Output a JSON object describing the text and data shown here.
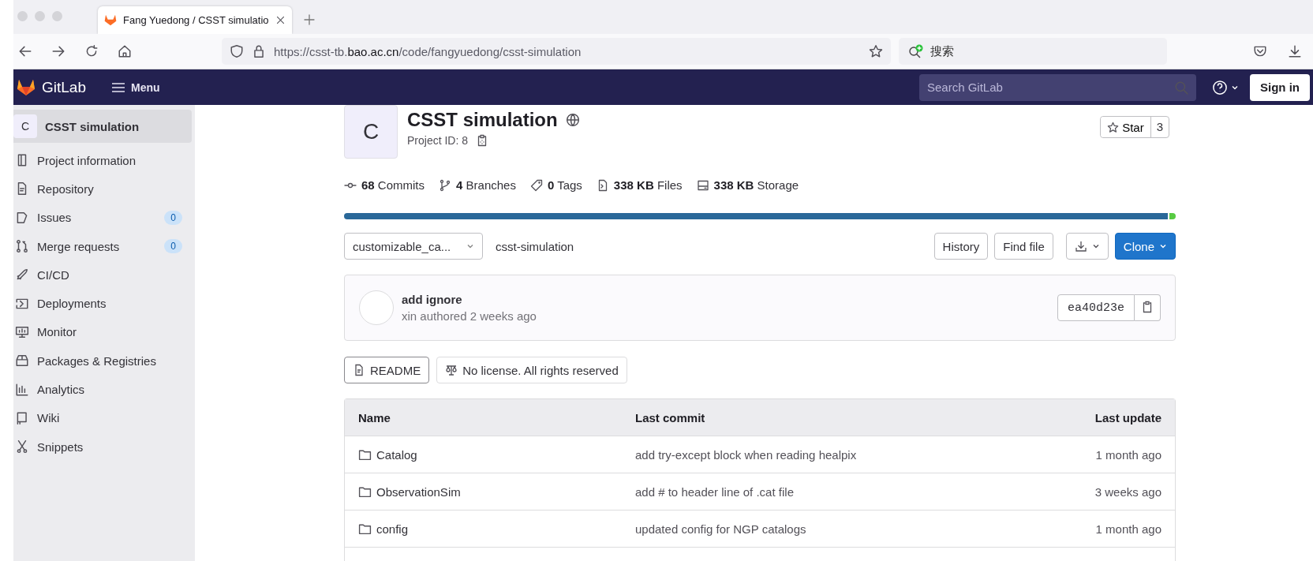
{
  "browser": {
    "tab": {
      "title": "Fang Yuedong / CSST simulatio",
      "selected": true
    },
    "url": {
      "scheme": "https://csst-tb.",
      "domain": "bao.ac.cn",
      "path": "/code/fangyuedong/csst-simulation"
    },
    "search": {
      "placeholder": "搜索"
    }
  },
  "navbar": {
    "brand": "GitLab",
    "menu": "Menu",
    "search": {
      "placeholder": "Search GitLab"
    },
    "sign_in": "Sign in"
  },
  "sidebar": {
    "project": {
      "avatar": "C",
      "name": "CSST simulation"
    },
    "items": [
      {
        "label": "Project information"
      },
      {
        "label": "Repository"
      },
      {
        "label": "Issues",
        "count": "0"
      },
      {
        "label": "Merge requests",
        "count": "0"
      },
      {
        "label": "CI/CD"
      },
      {
        "label": "Deployments"
      },
      {
        "label": "Monitor"
      },
      {
        "label": "Packages & Registries"
      },
      {
        "label": "Analytics"
      },
      {
        "label": "Wiki"
      },
      {
        "label": "Snippets"
      }
    ]
  },
  "project": {
    "avatar": "C",
    "title": "CSST simulation",
    "id": "Project ID: 8",
    "star": {
      "label": "Star",
      "count": "3"
    },
    "stats": [
      {
        "count": "68",
        "label": "Commits"
      },
      {
        "count": "4",
        "label": "Branches"
      },
      {
        "count": "0",
        "label": "Tags"
      },
      {
        "count": "338 KB",
        "label": "Files"
      },
      {
        "count": "338 KB",
        "label": "Storage"
      }
    ]
  },
  "repo": {
    "branch": "customizable_ca...",
    "path": "csst-simulation",
    "buttons": [
      "History",
      "Find file"
    ],
    "clone": "Clone"
  },
  "last_commit": {
    "message": "add ignore",
    "meta": "xin authored 2 weeks ago",
    "sha": "ea40d23e"
  },
  "badges": [
    {
      "label": "README"
    },
    {
      "label": "No license. All rights reserved"
    }
  ],
  "table": {
    "columns": [
      "Name",
      "Last commit",
      "Last update"
    ],
    "rows": [
      {
        "name": "Catalog",
        "commit": "add try-except block when reading healpix",
        "updated": "1 month ago"
      },
      {
        "name": "ObservationSim",
        "commit": "add # to header line of .cat file",
        "updated": "3 weeks ago"
      },
      {
        "name": "config",
        "commit": "updated config for NGP catalogs",
        "updated": "1 month ago"
      }
    ]
  }
}
